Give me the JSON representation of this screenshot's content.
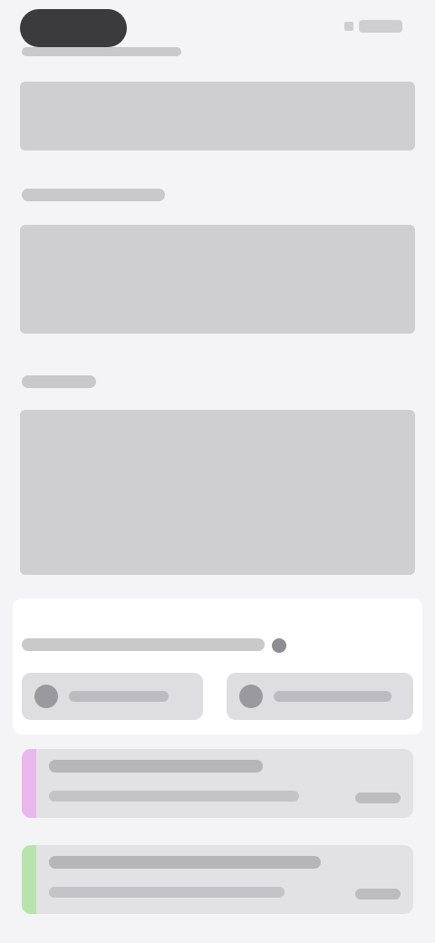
{
  "status_bar": {
    "left_pill": "",
    "right_indicators": ""
  },
  "sections": [
    {
      "label": "",
      "field": ""
    },
    {
      "label": "",
      "field": ""
    },
    {
      "label": "",
      "field": ""
    }
  ],
  "panel": {
    "heading": "",
    "buttons": [
      {
        "label": ""
      },
      {
        "label": ""
      }
    ]
  },
  "list": [
    {
      "title": "",
      "subtitle": "",
      "tag": "",
      "accent": "#e9b6ee"
    },
    {
      "title": "",
      "subtitle": "",
      "tag": "",
      "accent": "#b9e3ac"
    }
  ]
}
